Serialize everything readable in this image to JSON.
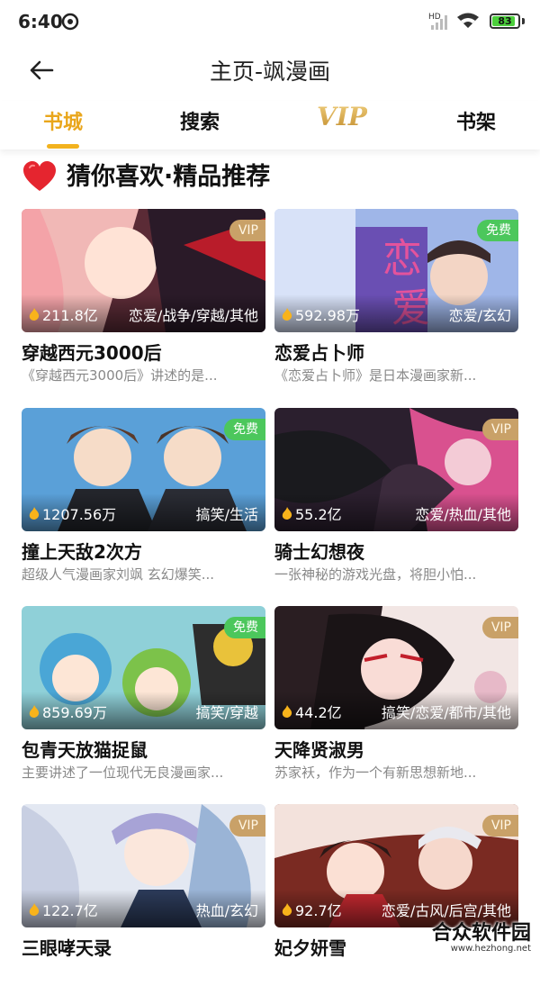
{
  "status": {
    "time": "6:40",
    "battery": "83",
    "network": "HD"
  },
  "header": {
    "title": "主页-飒漫画"
  },
  "tabs": [
    {
      "label": "书城",
      "active": true
    },
    {
      "label": "搜索",
      "active": false
    },
    {
      "label": "VIP",
      "active": false
    },
    {
      "label": "书架",
      "active": false
    }
  ],
  "section": {
    "title": "猜你喜欢·精品推荐"
  },
  "comics": [
    {
      "badge": "VIP",
      "popularity": "211.8亿",
      "tags": "恋爱/战争/穿越/其他",
      "name": "穿越西元3000后",
      "desc": "《穿越西元3000后》讲述的是..."
    },
    {
      "badge": "免费",
      "popularity": "592.98万",
      "tags": "恋爱/玄幻",
      "name": "恋爱占卜师",
      "desc": "《恋爱占卜师》是日本漫画家新..."
    },
    {
      "badge": "免费",
      "popularity": "1207.56万",
      "tags": "搞笑/生活",
      "name": "撞上天敌2次方",
      "desc": "超级人气漫画家刘飒 玄幻爆笑..."
    },
    {
      "badge": "VIP",
      "popularity": "55.2亿",
      "tags": "恋爱/热血/其他",
      "name": "骑士幻想夜",
      "desc": "一张神秘的游戏光盘，将胆小怕..."
    },
    {
      "badge": "免费",
      "popularity": "859.69万",
      "tags": "搞笑/穿越",
      "name": "包青天放猫捉鼠",
      "desc": "主要讲述了一位现代无良漫画家..."
    },
    {
      "badge": "VIP",
      "popularity": "44.2亿",
      "tags": "搞笑/恋爱/都市/其他",
      "name": "天降贤淑男",
      "desc": "苏家袄，作为一个有新思想新地..."
    },
    {
      "badge": "VIP",
      "popularity": "122.7亿",
      "tags": "热血/玄幻",
      "name": "三眼哮天录",
      "desc": ""
    },
    {
      "badge": "VIP",
      "popularity": "92.7亿",
      "tags": "恋爱/古风/后宫/其他",
      "name": "妃夕妍雪",
      "desc": ""
    }
  ],
  "watermark": {
    "main": "合众软件园",
    "sub": "www.hezhong.net"
  },
  "colors": {
    "accent": "#f2b21e",
    "vip_badge": "#c9a168",
    "free_badge": "#4cc75c"
  }
}
